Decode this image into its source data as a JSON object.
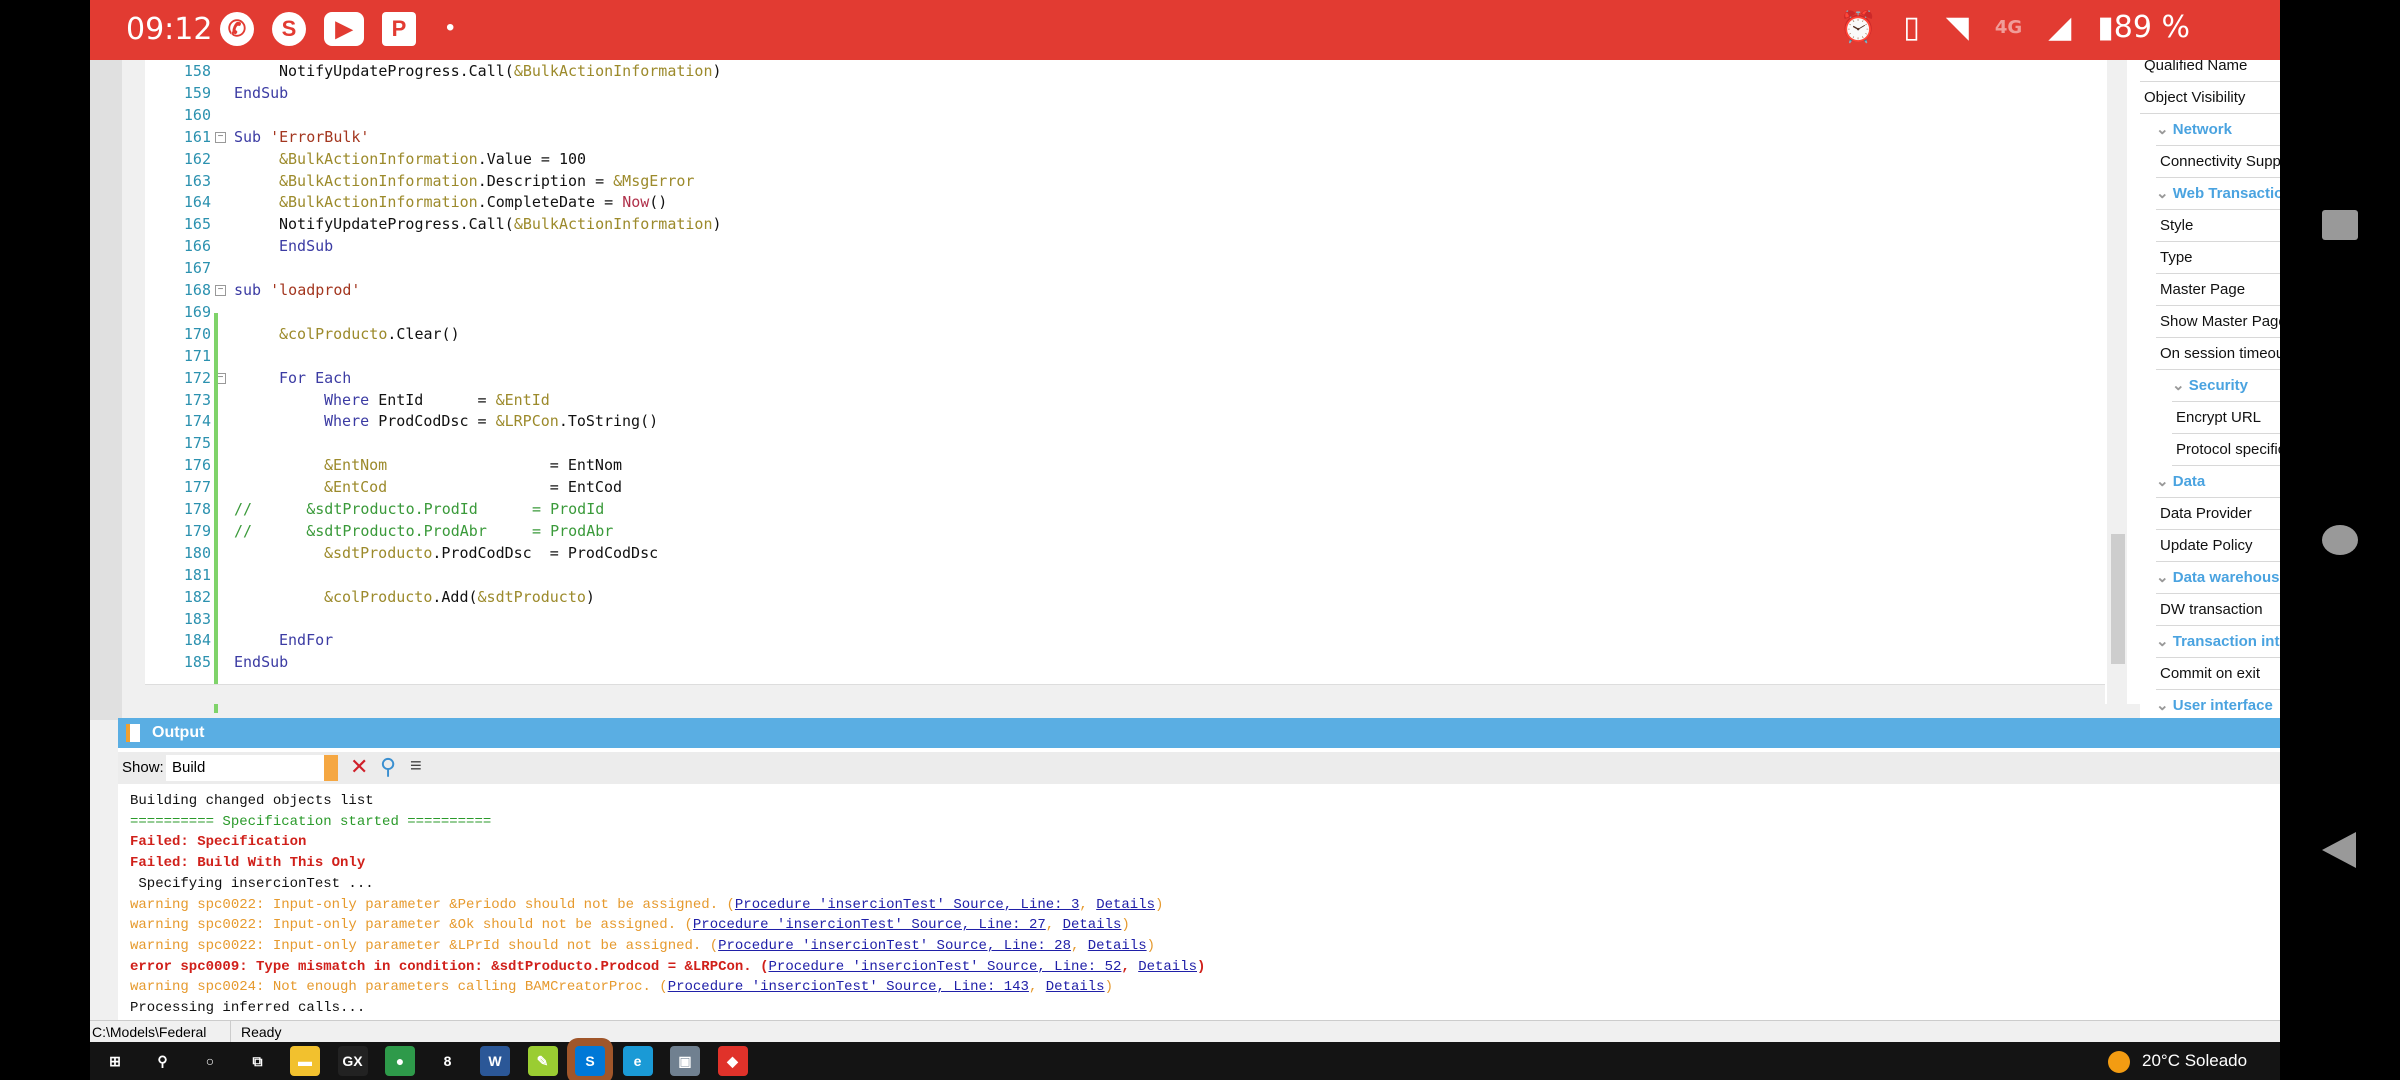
{
  "status_bar": {
    "time": "09:12",
    "network": "4G",
    "battery": "89 %",
    "icons": [
      "whatsapp-icon",
      "skype-icon",
      "youtube-icon",
      "p-app-icon",
      "dot-icon",
      "alarm-icon",
      "vibrate-icon",
      "wifi-icon",
      "signal-icon",
      "battery-icon"
    ]
  },
  "code_lines": [
    {
      "n": "158",
      "ind": 2,
      "tokens": [
        {
          "t": "NotifyUpdateProgress.Call(",
          "c": "tx"
        },
        {
          "t": "&BulkActionInformation",
          "c": "var"
        },
        {
          "t": ")",
          "c": "tx"
        }
      ]
    },
    {
      "n": "159",
      "ind": 0,
      "tokens": [
        {
          "t": "EndSub",
          "c": "kw"
        }
      ]
    },
    {
      "n": "160",
      "ind": 0,
      "tokens": []
    },
    {
      "n": "161",
      "ind": 0,
      "tokens": [
        {
          "t": "Sub ",
          "c": "kw"
        },
        {
          "t": "'ErrorBulk'",
          "c": "str"
        }
      ]
    },
    {
      "n": "162",
      "ind": 2,
      "tokens": [
        {
          "t": "&BulkActionInformation",
          "c": "var"
        },
        {
          "t": ".Value = 100",
          "c": "tx"
        }
      ]
    },
    {
      "n": "163",
      "ind": 2,
      "tokens": [
        {
          "t": "&BulkActionInformation",
          "c": "var"
        },
        {
          "t": ".Description = ",
          "c": "tx"
        },
        {
          "t": "&MsgError",
          "c": "var"
        }
      ]
    },
    {
      "n": "164",
      "ind": 2,
      "tokens": [
        {
          "t": "&BulkActionInformation",
          "c": "var"
        },
        {
          "t": ".CompleteDate = ",
          "c": "tx"
        },
        {
          "t": "Now",
          "c": "fn"
        },
        {
          "t": "()",
          "c": "tx"
        }
      ]
    },
    {
      "n": "165",
      "ind": 2,
      "tokens": [
        {
          "t": "NotifyUpdateProgress.Call(",
          "c": "tx"
        },
        {
          "t": "&BulkActionInformation",
          "c": "var"
        },
        {
          "t": ")",
          "c": "tx"
        }
      ]
    },
    {
      "n": "166",
      "ind": 2,
      "tokens": [
        {
          "t": "EndSub",
          "c": "kw"
        }
      ]
    },
    {
      "n": "167",
      "ind": 0,
      "tokens": []
    },
    {
      "n": "168",
      "ind": 0,
      "tokens": [
        {
          "t": "sub ",
          "c": "kw"
        },
        {
          "t": "'loadprod'",
          "c": "str"
        }
      ]
    },
    {
      "n": "169",
      "ind": 0,
      "tokens": []
    },
    {
      "n": "170",
      "ind": 2,
      "tokens": [
        {
          "t": "&colProducto",
          "c": "var"
        },
        {
          "t": ".Clear()",
          "c": "tx"
        }
      ]
    },
    {
      "n": "171",
      "ind": 0,
      "tokens": []
    },
    {
      "n": "172",
      "ind": 2,
      "tokens": [
        {
          "t": "For Each",
          "c": "kw"
        }
      ]
    },
    {
      "n": "173",
      "ind": 4,
      "tokens": [
        {
          "t": "Where ",
          "c": "kw"
        },
        {
          "t": "EntId      = ",
          "c": "tx"
        },
        {
          "t": "&EntId",
          "c": "var"
        }
      ]
    },
    {
      "n": "174",
      "ind": 4,
      "tokens": [
        {
          "t": "Where ",
          "c": "kw"
        },
        {
          "t": "ProdCodDsc = ",
          "c": "tx"
        },
        {
          "t": "&LRPCon",
          "c": "var"
        },
        {
          "t": ".ToString()",
          "c": "tx"
        }
      ]
    },
    {
      "n": "175",
      "ind": 0,
      "tokens": []
    },
    {
      "n": "176",
      "ind": 4,
      "tokens": [
        {
          "t": "&EntNom",
          "c": "var"
        },
        {
          "t": "                  = EntNom",
          "c": "tx"
        }
      ]
    },
    {
      "n": "177",
      "ind": 4,
      "tokens": [
        {
          "t": "&EntCod",
          "c": "var"
        },
        {
          "t": "                  = EntCod",
          "c": "tx"
        }
      ]
    },
    {
      "n": "178",
      "ind": 0,
      "tokens": [
        {
          "t": "//      &sdtProducto.ProdId      = ProdId",
          "c": "cm"
        }
      ]
    },
    {
      "n": "179",
      "ind": 0,
      "tokens": [
        {
          "t": "//      &sdtProducto.ProdAbr     = ProdAbr",
          "c": "cm"
        }
      ]
    },
    {
      "n": "180",
      "ind": 4,
      "tokens": [
        {
          "t": "&sdtProducto",
          "c": "var"
        },
        {
          "t": ".ProdCodDsc  = ProdCodDsc",
          "c": "tx"
        }
      ]
    },
    {
      "n": "181",
      "ind": 0,
      "tokens": []
    },
    {
      "n": "182",
      "ind": 4,
      "tokens": [
        {
          "t": "&colProducto",
          "c": "var"
        },
        {
          "t": ".Add(",
          "c": "tx"
        },
        {
          "t": "&sdtProducto",
          "c": "var"
        },
        {
          "t": ")",
          "c": "tx"
        }
      ]
    },
    {
      "n": "183",
      "ind": 0,
      "tokens": []
    },
    {
      "n": "184",
      "ind": 2,
      "tokens": [
        {
          "t": "EndFor",
          "c": "kw"
        }
      ]
    },
    {
      "n": "185",
      "ind": 0,
      "tokens": [
        {
          "t": "EndSub",
          "c": "kw"
        }
      ]
    }
  ],
  "properties": [
    {
      "label": "Qualified Name",
      "cat": false,
      "lvl": 0
    },
    {
      "label": "Object Visibility",
      "cat": false,
      "lvl": 0
    },
    {
      "label": "Network",
      "cat": true,
      "lvl": 1
    },
    {
      "label": "Connectivity Support",
      "cat": false,
      "lvl": 1
    },
    {
      "label": "Web Transaction",
      "cat": true,
      "lvl": 1
    },
    {
      "label": "Style",
      "cat": false,
      "lvl": 1
    },
    {
      "label": "Type",
      "cat": false,
      "lvl": 1
    },
    {
      "label": "Master Page",
      "cat": false,
      "lvl": 1
    },
    {
      "label": "Show Master Page",
      "cat": false,
      "lvl": 1
    },
    {
      "label": "On session timeout",
      "cat": false,
      "lvl": 1
    },
    {
      "label": "Security",
      "cat": true,
      "lvl": 2
    },
    {
      "label": "Encrypt URL",
      "cat": false,
      "lvl": 2
    },
    {
      "label": "Protocol specification",
      "cat": false,
      "lvl": 2
    },
    {
      "label": "Data",
      "cat": true,
      "lvl": 1
    },
    {
      "label": "Data Provider",
      "cat": false,
      "lvl": 1
    },
    {
      "label": "Update Policy",
      "cat": false,
      "lvl": 1
    },
    {
      "label": "Data warehouse",
      "cat": true,
      "lvl": 1
    },
    {
      "label": "DW transaction",
      "cat": false,
      "lvl": 1
    },
    {
      "label": "Transaction integrity",
      "cat": true,
      "lvl": 1
    },
    {
      "label": "Commit on exit",
      "cat": false,
      "lvl": 1
    },
    {
      "label": "User interface",
      "cat": true,
      "lvl": 1
    }
  ],
  "output": {
    "title": "Output",
    "show_label": "Show:",
    "show_value": "Build",
    "lines": [
      [
        {
          "t": "Building changed objects list",
          "c": "def"
        }
      ],
      [
        {
          "t": "========== Specification started ==========",
          "c": "green"
        }
      ],
      [
        {
          "t": "Failed: Specification",
          "c": "red"
        }
      ],
      [
        {
          "t": "Failed: Build With This Only",
          "c": "red"
        }
      ],
      [
        {
          "t": " Specifying insercionTest ...",
          "c": "def"
        }
      ],
      [
        {
          "t": "warning spc0022: Input-only parameter &Periodo should not be assigned. (",
          "c": "warn"
        },
        {
          "t": "Procedure 'insercionTest' Source, Line: 3",
          "c": "link"
        },
        {
          "t": ", ",
          "c": "warn"
        },
        {
          "t": "Details",
          "c": "link"
        },
        {
          "t": ")",
          "c": "warn"
        }
      ],
      [
        {
          "t": "warning spc0022: Input-only parameter &Ok should not be assigned. (",
          "c": "warn"
        },
        {
          "t": "Procedure 'insercionTest' Source, Line: 27",
          "c": "link"
        },
        {
          "t": ", ",
          "c": "warn"
        },
        {
          "t": "Details",
          "c": "link"
        },
        {
          "t": ")",
          "c": "warn"
        }
      ],
      [
        {
          "t": "warning spc0022: Input-only parameter &LPrId should not be assigned. (",
          "c": "warn"
        },
        {
          "t": "Procedure 'insercionTest' Source, Line: 28",
          "c": "link"
        },
        {
          "t": ", ",
          "c": "warn"
        },
        {
          "t": "Details",
          "c": "link"
        },
        {
          "t": ")",
          "c": "warn"
        }
      ],
      [
        {
          "t": "error spc0009: Type mismatch in condition: &sdtProducto.Prodcod = &LRPCon. (",
          "c": "red"
        },
        {
          "t": "Procedure 'insercionTest' Source, Line: 52",
          "c": "link"
        },
        {
          "t": ", ",
          "c": "red"
        },
        {
          "t": "Details",
          "c": "link"
        },
        {
          "t": ")",
          "c": "red"
        }
      ],
      [
        {
          "t": "warning spc0024: Not enough parameters calling BAMCreatorProc. (",
          "c": "warn"
        },
        {
          "t": "Procedure 'insercionTest' Source, Line: 143",
          "c": "link"
        },
        {
          "t": ", ",
          "c": "warn"
        },
        {
          "t": "Details",
          "c": "link"
        },
        {
          "t": ")",
          "c": "warn"
        }
      ],
      [
        {
          "t": "Processing inferred calls...",
          "c": "def"
        }
      ]
    ]
  },
  "app_status": {
    "path": "C:\\Models\\Federal",
    "state": "Ready"
  },
  "taskbar": {
    "apps": [
      {
        "name": "start",
        "label": "⊞",
        "bg": "transparent"
      },
      {
        "name": "search",
        "label": "⚲",
        "bg": "transparent"
      },
      {
        "name": "cortana",
        "label": "○",
        "bg": "transparent"
      },
      {
        "name": "task-view",
        "label": "⧉",
        "bg": "transparent"
      },
      {
        "name": "file-explorer",
        "label": "▬",
        "bg": "#f2c12e"
      },
      {
        "name": "genexus",
        "label": "GX",
        "bg": "#222"
      },
      {
        "name": "chrome",
        "label": "●",
        "bg": "#2e9a4a"
      },
      {
        "name": "app-8",
        "label": "8",
        "bg": "transparent"
      },
      {
        "name": "word",
        "label": "W",
        "bg": "#2b5797"
      },
      {
        "name": "notepad",
        "label": "✎",
        "bg": "#9acd32"
      },
      {
        "name": "skype",
        "label": "S",
        "bg": "#0078d7"
      },
      {
        "name": "edge",
        "label": "e",
        "bg": "#1a9ad6"
      },
      {
        "name": "monitor",
        "label": "▣",
        "bg": "#708090"
      },
      {
        "name": "screen-recorder",
        "label": "◆",
        "bg": "#e0322a"
      }
    ],
    "weather": "20°C  Soleado"
  },
  "colors": {
    "status_bar": "#e23b32",
    "output_header": "#5aaee3",
    "keyword": "#3b3ba3",
    "variable": "#9c8a2b",
    "string": "#a3361f",
    "error": "#d0201a",
    "warning": "#e69a2e",
    "link": "#2020a8"
  }
}
